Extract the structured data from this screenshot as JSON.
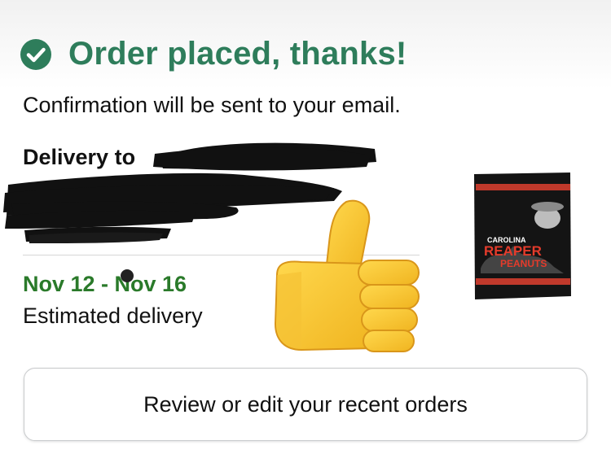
{
  "header": {
    "title": "Order placed, thanks!",
    "icon": "check-circle-icon",
    "accent_color": "#2e7d5b"
  },
  "confirmation_text": "Confirmation will be sent to your email.",
  "delivery": {
    "label": "Delivery to"
  },
  "estimate": {
    "date_range": "Nov 12 - Nov 16",
    "date_color": "#2a7a2a",
    "label": "Estimated delivery"
  },
  "product": {
    "package_text_brand": "CAROLINA",
    "package_text_line1": "REAPER",
    "package_text_line2": "PEANUTS"
  },
  "overlay": {
    "emoji": "thumbs-up-icon"
  },
  "actions": {
    "review_label": "Review or edit your recent orders"
  }
}
